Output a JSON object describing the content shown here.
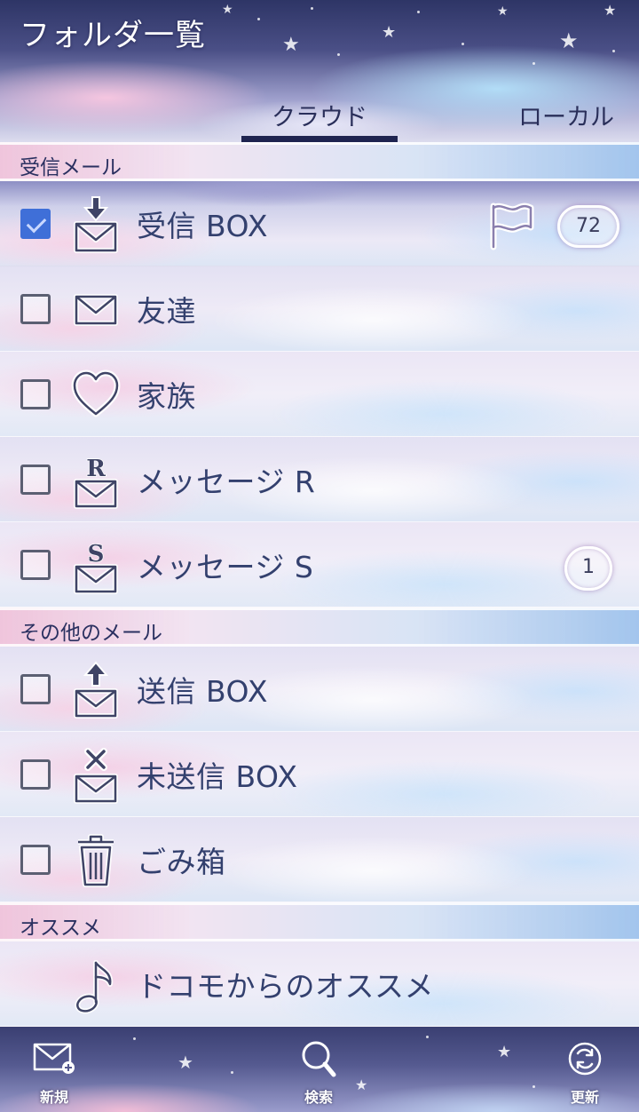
{
  "header": {
    "title": "フォルダ一覧",
    "tabs": [
      {
        "label": "クラウド",
        "selected": true
      },
      {
        "label": "ローカル",
        "selected": false
      }
    ]
  },
  "sections": [
    {
      "label": "受信メール",
      "folders": [
        {
          "name": "受信 BOX",
          "icon": "inbox-download-icon",
          "checked": true,
          "flag": true,
          "badge": "72"
        },
        {
          "name": "友達",
          "icon": "envelope-icon",
          "checked": false
        },
        {
          "name": "家族",
          "icon": "heart-icon",
          "checked": false
        },
        {
          "name": "メッセージ R",
          "icon": "envelope-r-icon",
          "checked": false,
          "icon_letter": "R"
        },
        {
          "name": "メッセージ S",
          "icon": "envelope-s-icon",
          "checked": false,
          "icon_letter": "S",
          "badge": "1"
        }
      ]
    },
    {
      "label": "その他のメール",
      "folders": [
        {
          "name": "送信 BOX",
          "icon": "outbox-upload-icon",
          "checked": false
        },
        {
          "name": "未送信 BOX",
          "icon": "unsent-x-icon",
          "checked": false
        },
        {
          "name": "ごみ箱",
          "icon": "trash-icon",
          "checked": false
        }
      ]
    },
    {
      "label": "オススメ",
      "folders": [
        {
          "name": "ドコモからのオススメ",
          "icon": "music-note-icon"
        }
      ]
    }
  ],
  "footer": {
    "new_label": "新規",
    "search_label": "検索",
    "refresh_label": "更新"
  },
  "colors": {
    "text": "#33406e",
    "checkbox_checked": "#3f6fd8",
    "tab_underline": "#1f2450"
  }
}
